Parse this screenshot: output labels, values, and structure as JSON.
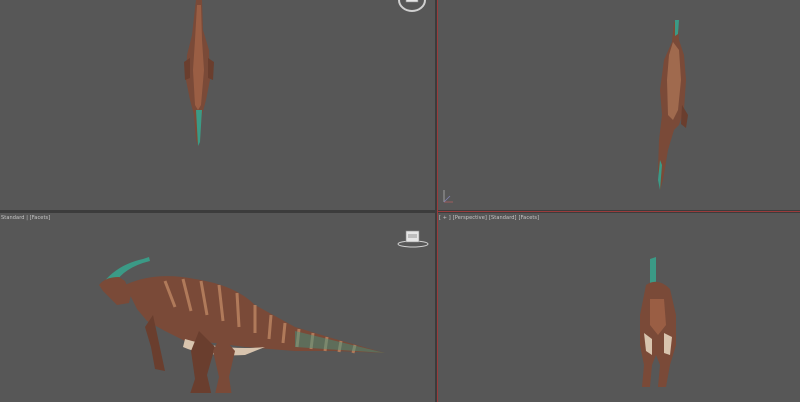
{
  "viewports": {
    "left": {
      "label": "Standard | [Facets]"
    },
    "perspective": {
      "label_parts": [
        "[ + ]",
        "[Perspective]",
        "[Standard]",
        "[Facets]"
      ]
    }
  },
  "colors": {
    "viewport_bg": "#575757",
    "divider": "#3c3c3c",
    "active_border": "#9a3c3c",
    "dino_body": "#7a4a38",
    "dino_stripe": "#b07a5a",
    "dino_crest": "#3b9a86",
    "dino_belly": "#d8c4ae"
  },
  "icons": {
    "viewcube_top": "viewcube-icon",
    "viewcube_left": "viewcube-icon",
    "axis_gizmo": "axis-gizmo-icon"
  }
}
